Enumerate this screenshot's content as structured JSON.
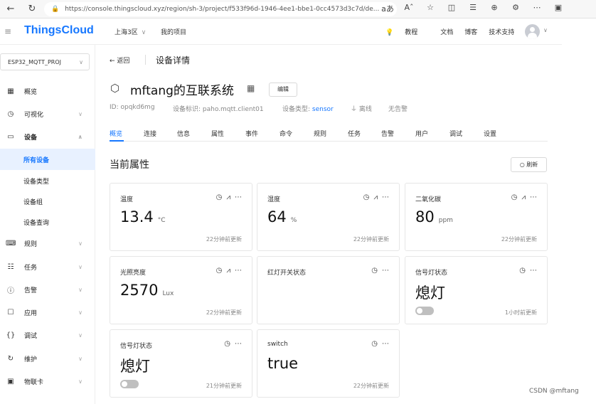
{
  "browser": {
    "url": "https://console.thingscloud.xyz/region/sh-3/project/f533f96d-1946-4ee1-bbe1-0cc4573d3c7d/de...",
    "lock_icon": "lock-icon",
    "reader_label": "aあ",
    "font_label": "Aˆ"
  },
  "header": {
    "brand": "ThingsCloud",
    "region": "上海3区",
    "my_project": "我的项目",
    "tutorial": "教程",
    "docs": "文档",
    "blog": "博客",
    "support": "技术支持",
    "accent_color": "#1677ff"
  },
  "sidebar": {
    "project": "ESP32_MQTT_PROJ",
    "items": [
      {
        "label": "概览",
        "icon": "grid-icon"
      },
      {
        "label": "可视化",
        "icon": "dashboard-icon"
      },
      {
        "label": "设备",
        "icon": "device-icon"
      },
      {
        "label": "所有设备"
      },
      {
        "label": "设备类型"
      },
      {
        "label": "设备组"
      },
      {
        "label": "设备查询"
      },
      {
        "label": "规则",
        "icon": "terminal-icon"
      },
      {
        "label": "任务",
        "icon": "task-icon"
      },
      {
        "label": "告警",
        "icon": "alert-icon"
      },
      {
        "label": "应用",
        "icon": "app-icon"
      },
      {
        "label": "调试",
        "icon": "braces-icon"
      },
      {
        "label": "维护",
        "icon": "wrench-icon"
      },
      {
        "label": "物联卡",
        "icon": "sim-card-icon"
      }
    ]
  },
  "page": {
    "back": "← 返回",
    "title": "设备详情",
    "device_name": "mftang的互联系统",
    "edit": "编辑",
    "id": "ID: opqkd6mg",
    "identifier": "设备标识: paho.mqtt.client01",
    "type_label": "设备类型: ",
    "type_value": "sensor",
    "status": "离线",
    "alarm": "无告警",
    "tabs": [
      "概览",
      "连接",
      "信息",
      "属性",
      "事件",
      "命令",
      "规则",
      "任务",
      "告警",
      "用户",
      "调试",
      "设置"
    ],
    "active_tab": "概览",
    "section_title": "当前属性",
    "refresh": "刷新"
  },
  "cards": [
    {
      "name": "温度",
      "value": "13.4",
      "unit": "°C",
      "time": "22分钟前更新",
      "chart": true,
      "toggle": false
    },
    {
      "name": "湿度",
      "value": "64",
      "unit": "%",
      "time": "22分钟前更新",
      "chart": true,
      "toggle": false
    },
    {
      "name": "二氧化碳",
      "value": "80",
      "unit": "ppm",
      "time": "22分钟前更新",
      "chart": true,
      "toggle": false
    },
    {
      "name": "光照亮度",
      "value": "2570",
      "unit": "Lux",
      "time": "22分钟前更新",
      "chart": true,
      "toggle": false
    },
    {
      "name": "红灯开关状态",
      "value": "",
      "unit": "",
      "time": "",
      "chart": false,
      "toggle": false
    },
    {
      "name": "信号灯状态",
      "value": "熄灯",
      "unit": "",
      "time": "1小时前更新",
      "chart": false,
      "toggle": true
    },
    {
      "name": "信号灯状态",
      "value": "熄灯",
      "unit": "",
      "time": "21分钟前更新",
      "chart": false,
      "toggle": true
    },
    {
      "name": "switch",
      "value": "true",
      "unit": "",
      "time": "22分钟前更新",
      "chart": false,
      "toggle": false
    }
  ],
  "watermark": "CSDN @mftang"
}
